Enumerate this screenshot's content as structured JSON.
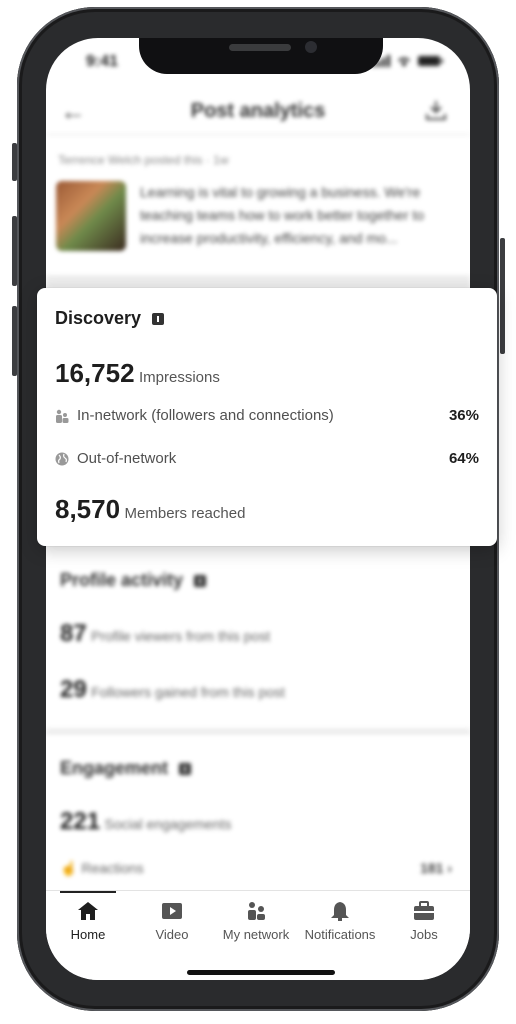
{
  "status": {
    "time": "9:41"
  },
  "header": {
    "title": "Post analytics"
  },
  "post": {
    "meta": "Terrence Welch posted this · 1w",
    "text": "Learning is vital to growing a business. We're teaching teams how to work better together to increase productivity, efficiency, and mo..."
  },
  "discovery": {
    "title": "Discovery",
    "impressions_value": "16,752",
    "impressions_label": "Impressions",
    "in_network_label": "In-network (followers and connections)",
    "in_network_value": "36%",
    "out_network_label": "Out-of-network",
    "out_network_value": "64%",
    "members_value": "8,570",
    "members_label": "Members reached"
  },
  "profile_activity": {
    "title": "Profile activity",
    "viewers_value": "87",
    "viewers_label": "Profile viewers from this post",
    "followers_value": "29",
    "followers_label": "Followers gained from this post"
  },
  "engagement": {
    "title": "Engagement",
    "social_value": "221",
    "social_label": "Social engagements",
    "reactions_label": "Reactions",
    "reactions_value": "181"
  },
  "nav": {
    "items": [
      {
        "label": "Home",
        "icon": "home-icon"
      },
      {
        "label": "Video",
        "icon": "video-icon"
      },
      {
        "label": "My network",
        "icon": "network-icon"
      },
      {
        "label": "Notifications",
        "icon": "bell-icon"
      },
      {
        "label": "Jobs",
        "icon": "briefcase-icon"
      }
    ]
  }
}
